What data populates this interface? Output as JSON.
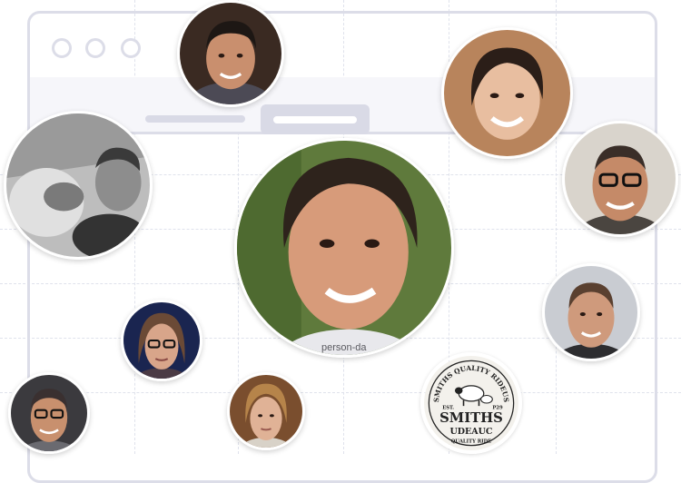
{
  "photo_caption": "person-da",
  "logo": {
    "arc_text": "SMITHS QUALITY RIDEUS",
    "est_left": "EST.",
    "est_right": "P29",
    "title": "SMITHS",
    "subtitle": "UDEAUC",
    "bottom_text": "QUALITY RIDE"
  },
  "colors": {
    "frame": "#dcdde8",
    "grid": "#dfe2ec"
  }
}
